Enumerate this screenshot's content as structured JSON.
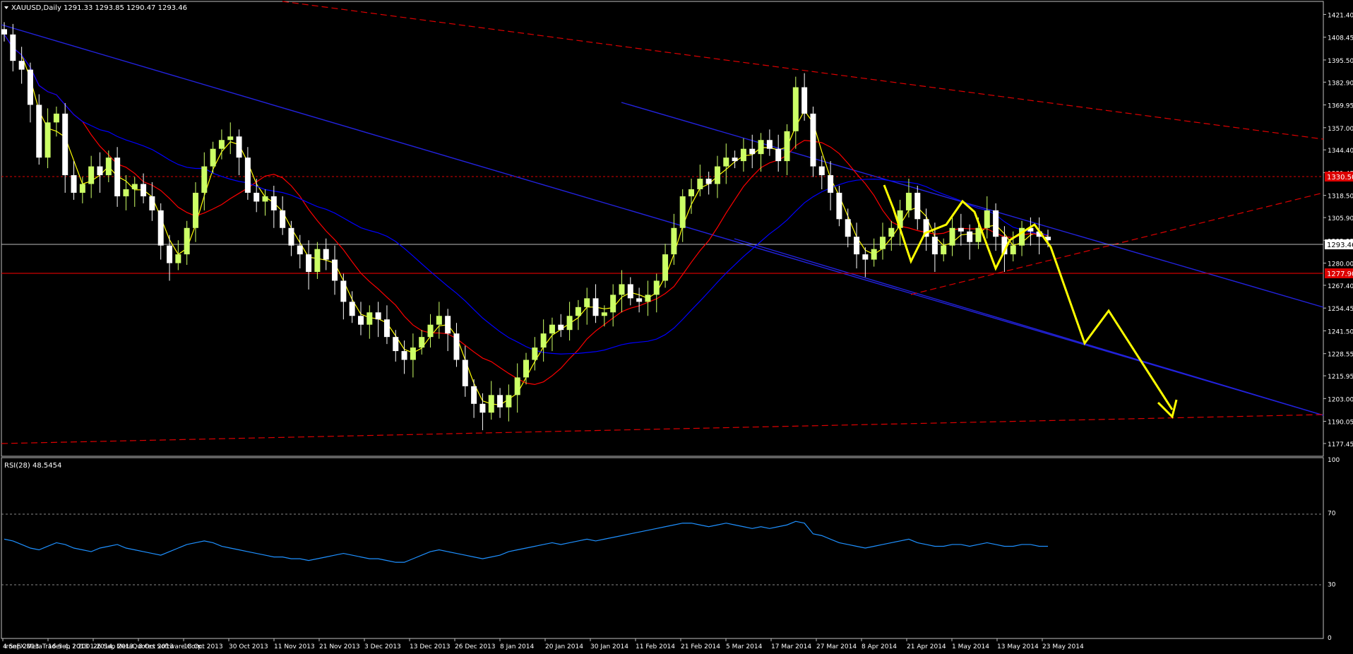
{
  "header": {
    "symbol": "XAUUSD,Daily",
    "ohlc": "1291.33 1293.85 1290.47 1293.46"
  },
  "rsi_header": "RSI(28) 48.5454",
  "copyright": "IronFX MetaTrader 4, ? 2001-2014, MetaQuotes Software Corp.",
  "colors": {
    "background": "#000000",
    "bull_candle": "#ccff66",
    "bear_candle": "#ffffff",
    "ma_fast": "#ffff00",
    "ma_mid": "#ff0000",
    "ma_slow": "#0000ff",
    "channel_blue": "#2222dd",
    "trend_red_dashed": "#dd0000",
    "projection": "#ffff00",
    "rsi_line": "#1e90ff",
    "axis": "#c0c0c0"
  },
  "chart_data": {
    "type": "candlestick",
    "ylim": [
      1171,
      1428
    ],
    "y_ticks": [
      "1421.40",
      "1408.45",
      "1395.50",
      "1382.90",
      "1369.95",
      "1357.00",
      "1344.40",
      "1331.45",
      "1318.50",
      "1305.90",
      "1292.95",
      "1280.00",
      "1267.40",
      "1254.45",
      "1241.50",
      "1228.55",
      "1215.95",
      "1203.00",
      "1190.05",
      "1177.45"
    ],
    "price_marker": "1293.46",
    "support_marker": "1277.90",
    "resistance_marker": "1330.50",
    "x_labels": [
      "4 Sep 2013",
      "16 Sep 2013",
      "26 Sep 2013",
      "8 Oct 2013",
      "18 Oct 2013",
      "30 Oct 2013",
      "11 Nov 2013",
      "21 Nov 2013",
      "3 Dec 2013",
      "13 Dec 2013",
      "26 Dec 2013",
      "8 Jan 2014",
      "20 Jan 2014",
      "30 Jan 2014",
      "11 Feb 2014",
      "21 Feb 2014",
      "5 Mar 2014",
      "17 Mar 2014",
      "27 Mar 2014",
      "8 Apr 2014",
      "21 Apr 2014",
      "1 May 2014",
      "13 May 2014",
      "23 May 2014"
    ],
    "closes": [
      1410,
      1395,
      1390,
      1370,
      1340,
      1360,
      1365,
      1330,
      1320,
      1325,
      1335,
      1330,
      1340,
      1318,
      1322,
      1325,
      1318,
      1310,
      1290,
      1280,
      1285,
      1300,
      1320,
      1335,
      1345,
      1350,
      1352,
      1340,
      1320,
      1315,
      1318,
      1310,
      1300,
      1290,
      1285,
      1275,
      1288,
      1282,
      1270,
      1258,
      1250,
      1245,
      1252,
      1248,
      1238,
      1230,
      1225,
      1232,
      1238,
      1245,
      1250,
      1240,
      1225,
      1210,
      1200,
      1195,
      1205,
      1198,
      1205,
      1215,
      1225,
      1232,
      1240,
      1245,
      1242,
      1250,
      1255,
      1260,
      1250,
      1252,
      1262,
      1268,
      1260,
      1258,
      1262,
      1270,
      1285,
      1300,
      1318,
      1322,
      1328,
      1325,
      1335,
      1340,
      1338,
      1345,
      1342,
      1350,
      1345,
      1338,
      1355,
      1380,
      1365,
      1335,
      1330,
      1320,
      1305,
      1295,
      1285,
      1282,
      1288,
      1295,
      1300,
      1310,
      1320,
      1305,
      1295,
      1285,
      1290,
      1300,
      1298,
      1292,
      1300,
      1310,
      1295,
      1285,
      1290,
      1300,
      1298,
      1295,
      1293
    ],
    "rsi": {
      "levels": [
        70,
        30
      ],
      "axis_ticks": [
        "100",
        "70",
        "30",
        "0"
      ],
      "values": [
        55,
        54,
        52,
        50,
        49,
        51,
        53,
        52,
        50,
        49,
        48,
        50,
        51,
        52,
        50,
        49,
        48,
        47,
        46,
        48,
        50,
        52,
        53,
        54,
        53,
        51,
        50,
        49,
        48,
        47,
        46,
        45,
        45,
        44,
        44,
        43,
        44,
        45,
        46,
        47,
        46,
        45,
        44,
        44,
        43,
        42,
        42,
        44,
        46,
        48,
        49,
        48,
        47,
        46,
        45,
        44,
        45,
        46,
        48,
        49,
        50,
        51,
        52,
        53,
        52,
        53,
        54,
        55,
        54,
        55,
        56,
        57,
        58,
        59,
        60,
        61,
        62,
        63,
        64,
        64,
        63,
        62,
        63,
        64,
        63,
        62,
        61,
        62,
        61,
        62,
        63,
        65,
        64,
        58,
        57,
        55,
        53,
        52,
        51,
        50,
        51,
        52,
        53,
        54,
        55,
        53,
        52,
        51,
        51,
        52,
        52,
        51,
        52,
        53,
        52,
        51,
        51,
        52,
        52,
        51,
        51
      ]
    }
  }
}
